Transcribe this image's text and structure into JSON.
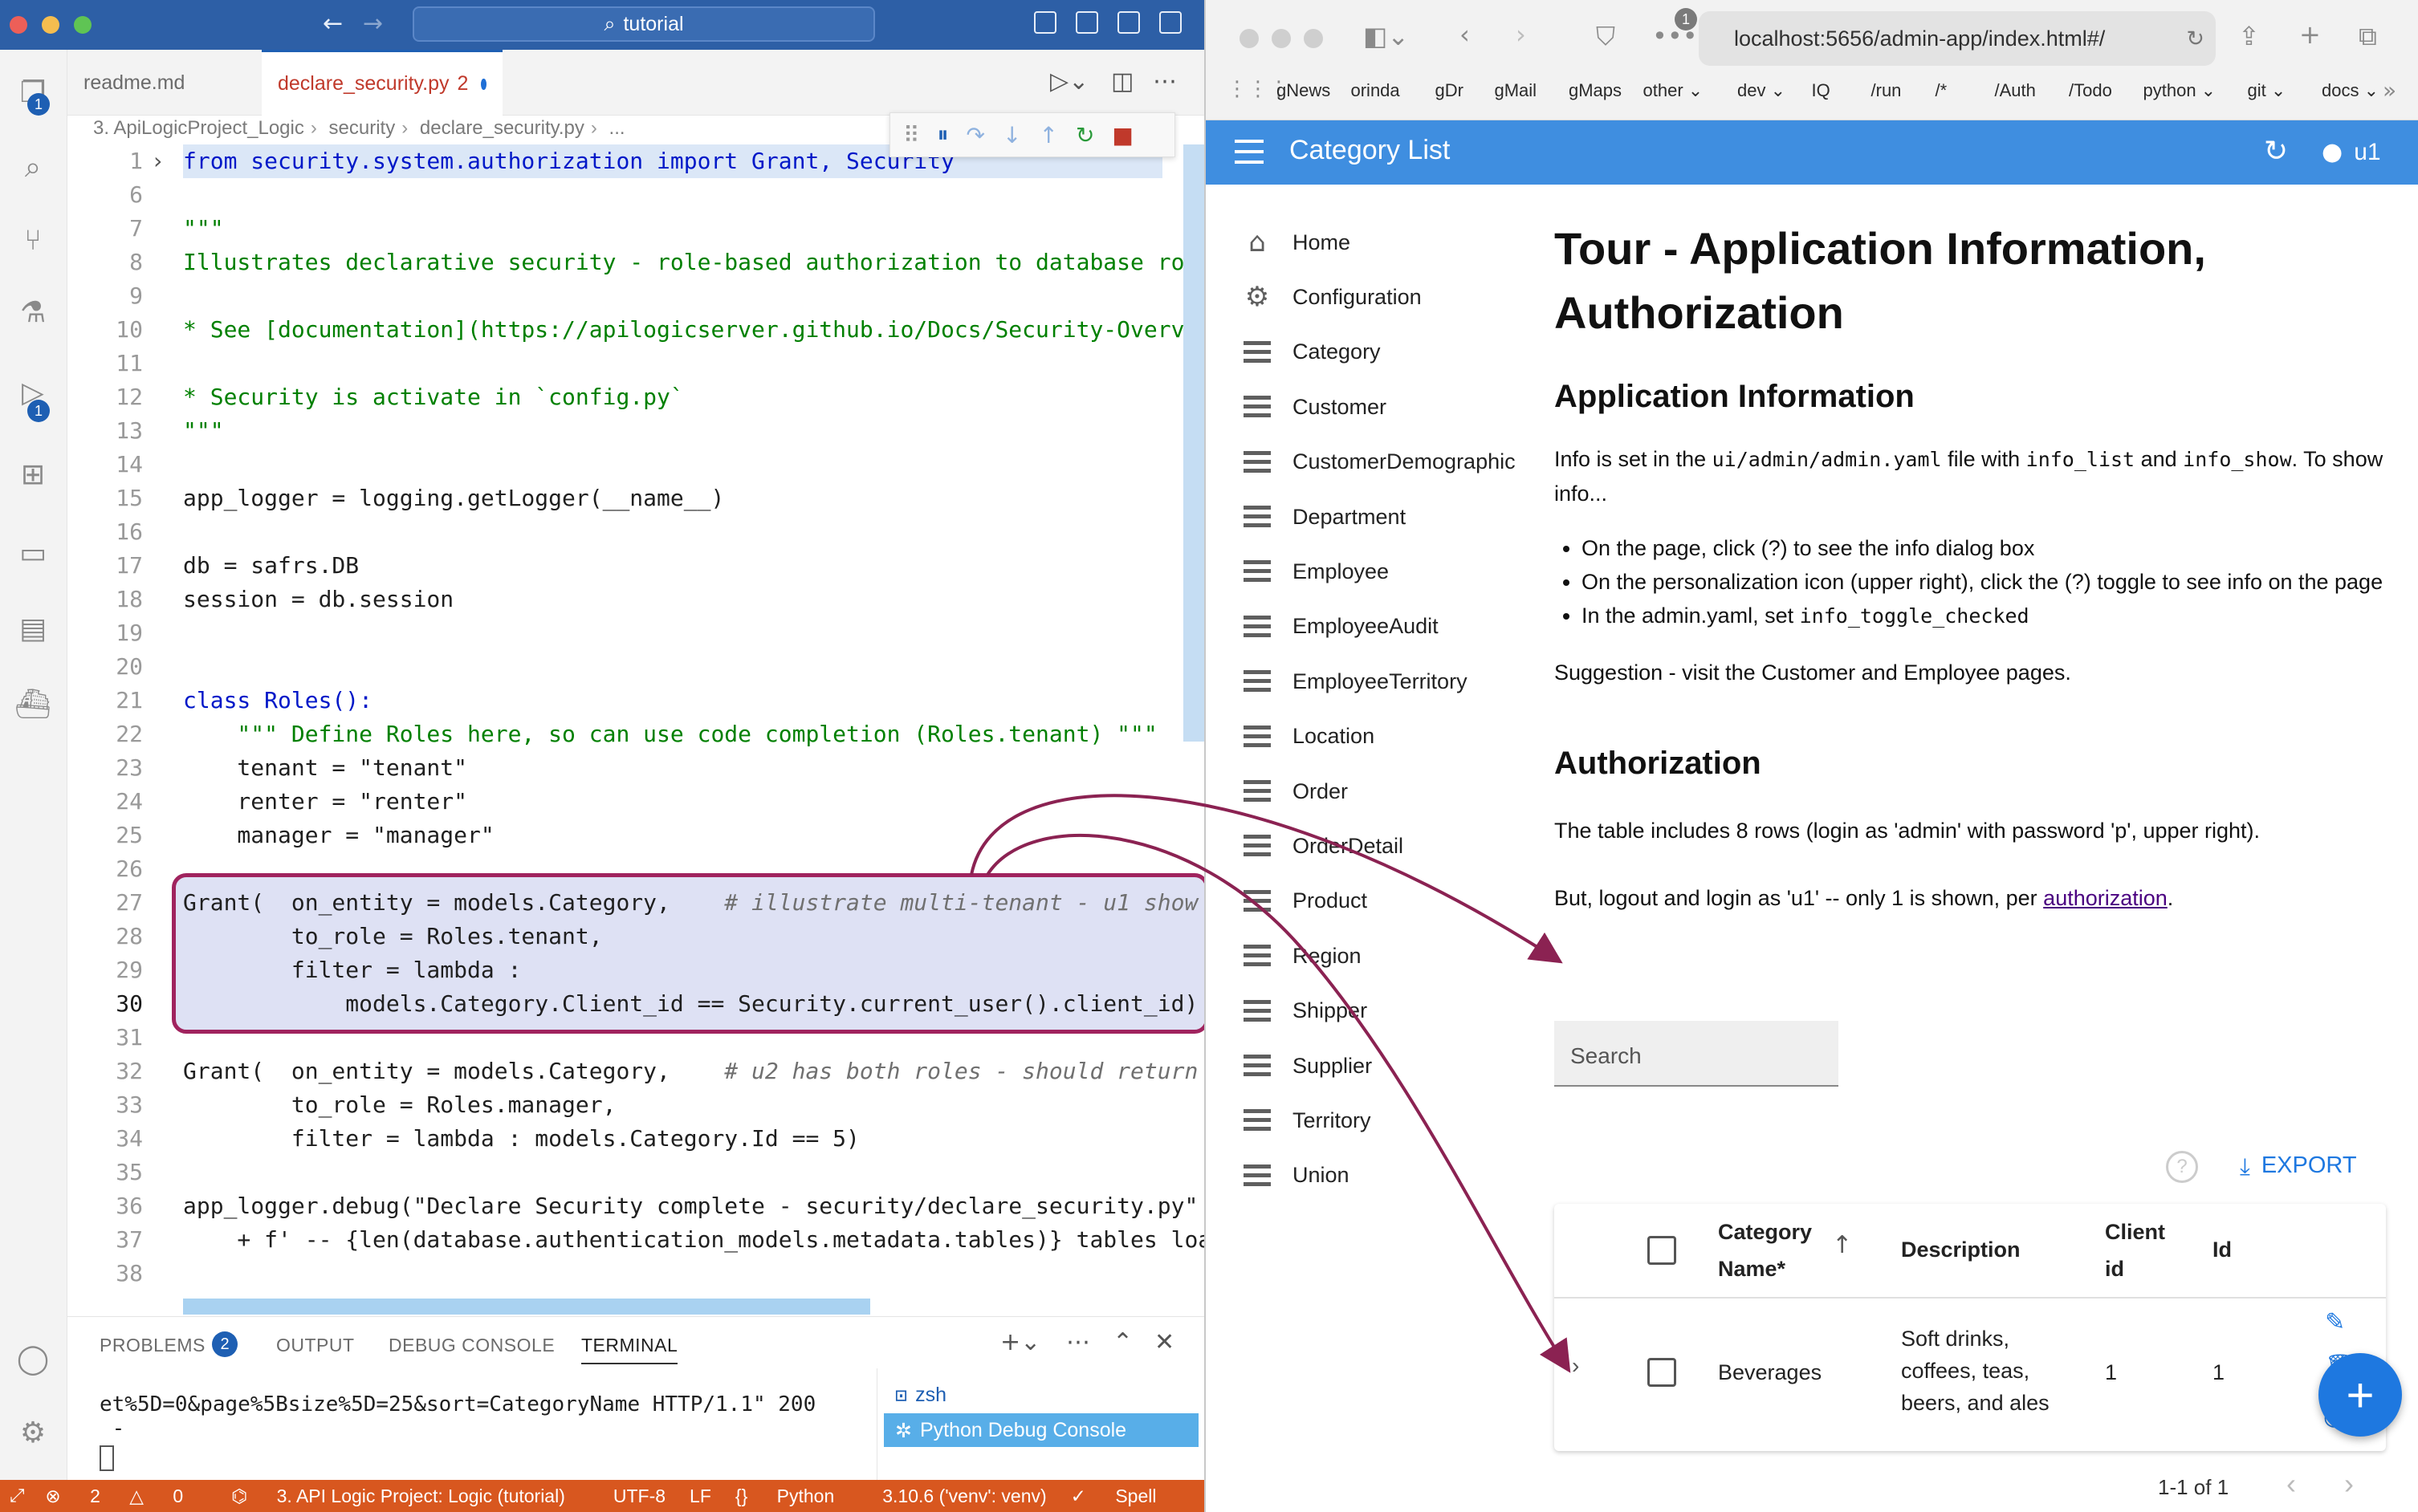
{
  "vscode": {
    "search_text": "tutorial",
    "tabs": [
      {
        "label": "readme.md"
      },
      {
        "label": "declare_security.py",
        "badge": "2"
      }
    ],
    "breadcrumbs": [
      "3. ApiLogicProject_Logic",
      "security",
      "declare_security.py",
      "..."
    ],
    "code_lines": [
      {
        "n": "1",
        "text": "from security.system.authorization import Grant, Security"
      },
      {
        "n": "6",
        "text": ""
      },
      {
        "n": "7",
        "text": "\"\"\""
      },
      {
        "n": "8",
        "text": "Illustrates declarative security - role-based authorization to database ro"
      },
      {
        "n": "9",
        "text": ""
      },
      {
        "n": "10",
        "text": "* See [documentation](https://apilogicserver.github.io/Docs/Security-Overv"
      },
      {
        "n": "11",
        "text": ""
      },
      {
        "n": "12",
        "text": "* Security is activate in `config.py`"
      },
      {
        "n": "13",
        "text": "\"\"\""
      },
      {
        "n": "14",
        "text": ""
      },
      {
        "n": "15",
        "text": "app_logger = logging.getLogger(__name__)"
      },
      {
        "n": "16",
        "text": ""
      },
      {
        "n": "17",
        "text": "db = safrs.DB"
      },
      {
        "n": "18",
        "text": "session = db.session"
      },
      {
        "n": "19",
        "text": ""
      },
      {
        "n": "20",
        "text": ""
      },
      {
        "n": "21",
        "text": "class Roles():"
      },
      {
        "n": "22",
        "text": "    \"\"\" Define Roles here, so can use code completion (Roles.tenant) \"\"\""
      },
      {
        "n": "23",
        "text": "    tenant = \"tenant\""
      },
      {
        "n": "24",
        "text": "    renter = \"renter\""
      },
      {
        "n": "25",
        "text": "    manager = \"manager\""
      },
      {
        "n": "26",
        "text": ""
      },
      {
        "n": "27",
        "text": "Grant(  on_entity = models.Category,    # illustrate multi-tenant - u1 show"
      },
      {
        "n": "28",
        "text": "        to_role = Roles.tenant,"
      },
      {
        "n": "29",
        "text": "        filter = lambda :"
      },
      {
        "n": "30",
        "text": "            models.Category.Client_id == Security.current_user().client_id)"
      },
      {
        "n": "31",
        "text": ""
      },
      {
        "n": "32",
        "text": "Grant(  on_entity = models.Category,    # u2 has both roles - should return"
      },
      {
        "n": "33",
        "text": "        to_role = Roles.manager,"
      },
      {
        "n": "34",
        "text": "        filter = lambda : models.Category.Id == 5)"
      },
      {
        "n": "35",
        "text": ""
      },
      {
        "n": "36",
        "text": "app_logger.debug(\"Declare Security complete - security/declare_security.py\""
      },
      {
        "n": "37",
        "text": "    + f' -- {len(database.authentication_models.metadata.tables)} tables loa"
      },
      {
        "n": "38",
        "text": ""
      }
    ],
    "panel_tabs": [
      "PROBLEMS",
      "OUTPUT",
      "DEBUG CONSOLE",
      "TERMINAL"
    ],
    "problems_count": "2",
    "terminal_text": "et%5D=0&page%5Bsize%5D=25&sort=CategoryName HTTP/1.1\" 200\n -",
    "terminal_list": [
      "zsh",
      "Python Debug Console"
    ],
    "activity_badges": [
      "1",
      "1"
    ],
    "status": {
      "errors": "2",
      "warnings": "0",
      "project": "3. API Logic Project: Logic (tutorial)",
      "encoding": "UTF-8",
      "eol": "LF",
      "language": "Python",
      "interpreter": "3.10.6 ('venv': venv)",
      "spell": "Spell"
    }
  },
  "browser": {
    "url": "localhost:5656/admin-app/index.html#/",
    "tab_badge": "1",
    "bookmarks": [
      "gNews",
      "orinda",
      "gDr",
      "gMail",
      "gMaps",
      "other ⌄",
      "dev ⌄",
      "IQ",
      "/run",
      "/*",
      "/Auth",
      "/Todo",
      "python ⌄",
      "git ⌄",
      "docs ⌄"
    ],
    "appbar_title": "Category List",
    "user": "u1",
    "sidebar": [
      "Home",
      "Configuration",
      "Category",
      "Customer",
      "CustomerDemographic",
      "Department",
      "Employee",
      "EmployeeAudit",
      "EmployeeTerritory",
      "Location",
      "Order",
      "OrderDetail",
      "Product",
      "Region",
      "Shipper",
      "Supplier",
      "Territory",
      "Union"
    ],
    "page": {
      "title": "Tour - Application Information, Authorization",
      "h_app": "Application Information",
      "info_1": "Info is set in the ",
      "info_code1": "ui/admin/admin.yaml",
      "info_2": " file with ",
      "info_code2": "info_list",
      "info_3": " and ",
      "info_code3": "info_show",
      "info_4": ". To show info...",
      "bullets": [
        "On the page, click (?) to see the info dialog box",
        "On the personalization icon (upper right), click the (?) toggle to see info on the page",
        "In the admin.yaml, set "
      ],
      "bullet3_code": "info_toggle_checked",
      "suggestion": "Suggestion - visit the Customer and Employee pages.",
      "h_auth": "Authorization",
      "auth_1": "The table includes 8 rows (login as 'admin' with password 'p', upper right).",
      "auth_2": "But, logout and login as 'u1' -- only 1 is shown, per ",
      "auth_link": "authorization",
      "auth_end": "."
    },
    "search_placeholder": "Search",
    "export_label": "EXPORT",
    "table": {
      "headers": [
        "Category Name*",
        "Description",
        "Client id",
        "Id"
      ],
      "rows": [
        {
          "name": "Beverages",
          "description": "Soft drinks, coffees, teas, beers, and ales",
          "client_id": "1",
          "id": "1"
        }
      ],
      "pagination": "1-1 of 1"
    }
  }
}
